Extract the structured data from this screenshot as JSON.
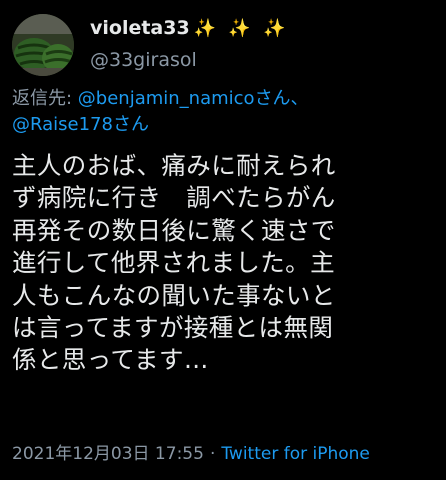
{
  "author": {
    "display_name": "violeta33",
    "sparkles": "✨ ✨ ✨",
    "handle": "@33girasol"
  },
  "reply": {
    "prefix": "返信先: ",
    "mention_1": "@benjamin_namico",
    "suffix_1": "さん、",
    "mention_2": "@Raise178",
    "suffix_2": "さん"
  },
  "body_lines": [
    "主人のおば、痛みに耐えられ",
    "ず病院に行き　調べたらがん",
    "再発その数日後に驚く速さで",
    "進行して他界されました。主",
    "人もこんなの聞いた事ないと",
    "は言ってますが接種とは無関",
    "係と思ってます…"
  ],
  "meta": {
    "timestamp": "2021年12月03日 17:55",
    "separator": "·",
    "source": "Twitter for iPhone"
  },
  "colors": {
    "background": "#000000",
    "text": "#e7e9ea",
    "secondary": "#8b98a5",
    "link": "#1d9bf0"
  },
  "icons": {
    "avatar": "watermelon-avatar",
    "sparkles": "sparkles-emoji"
  }
}
